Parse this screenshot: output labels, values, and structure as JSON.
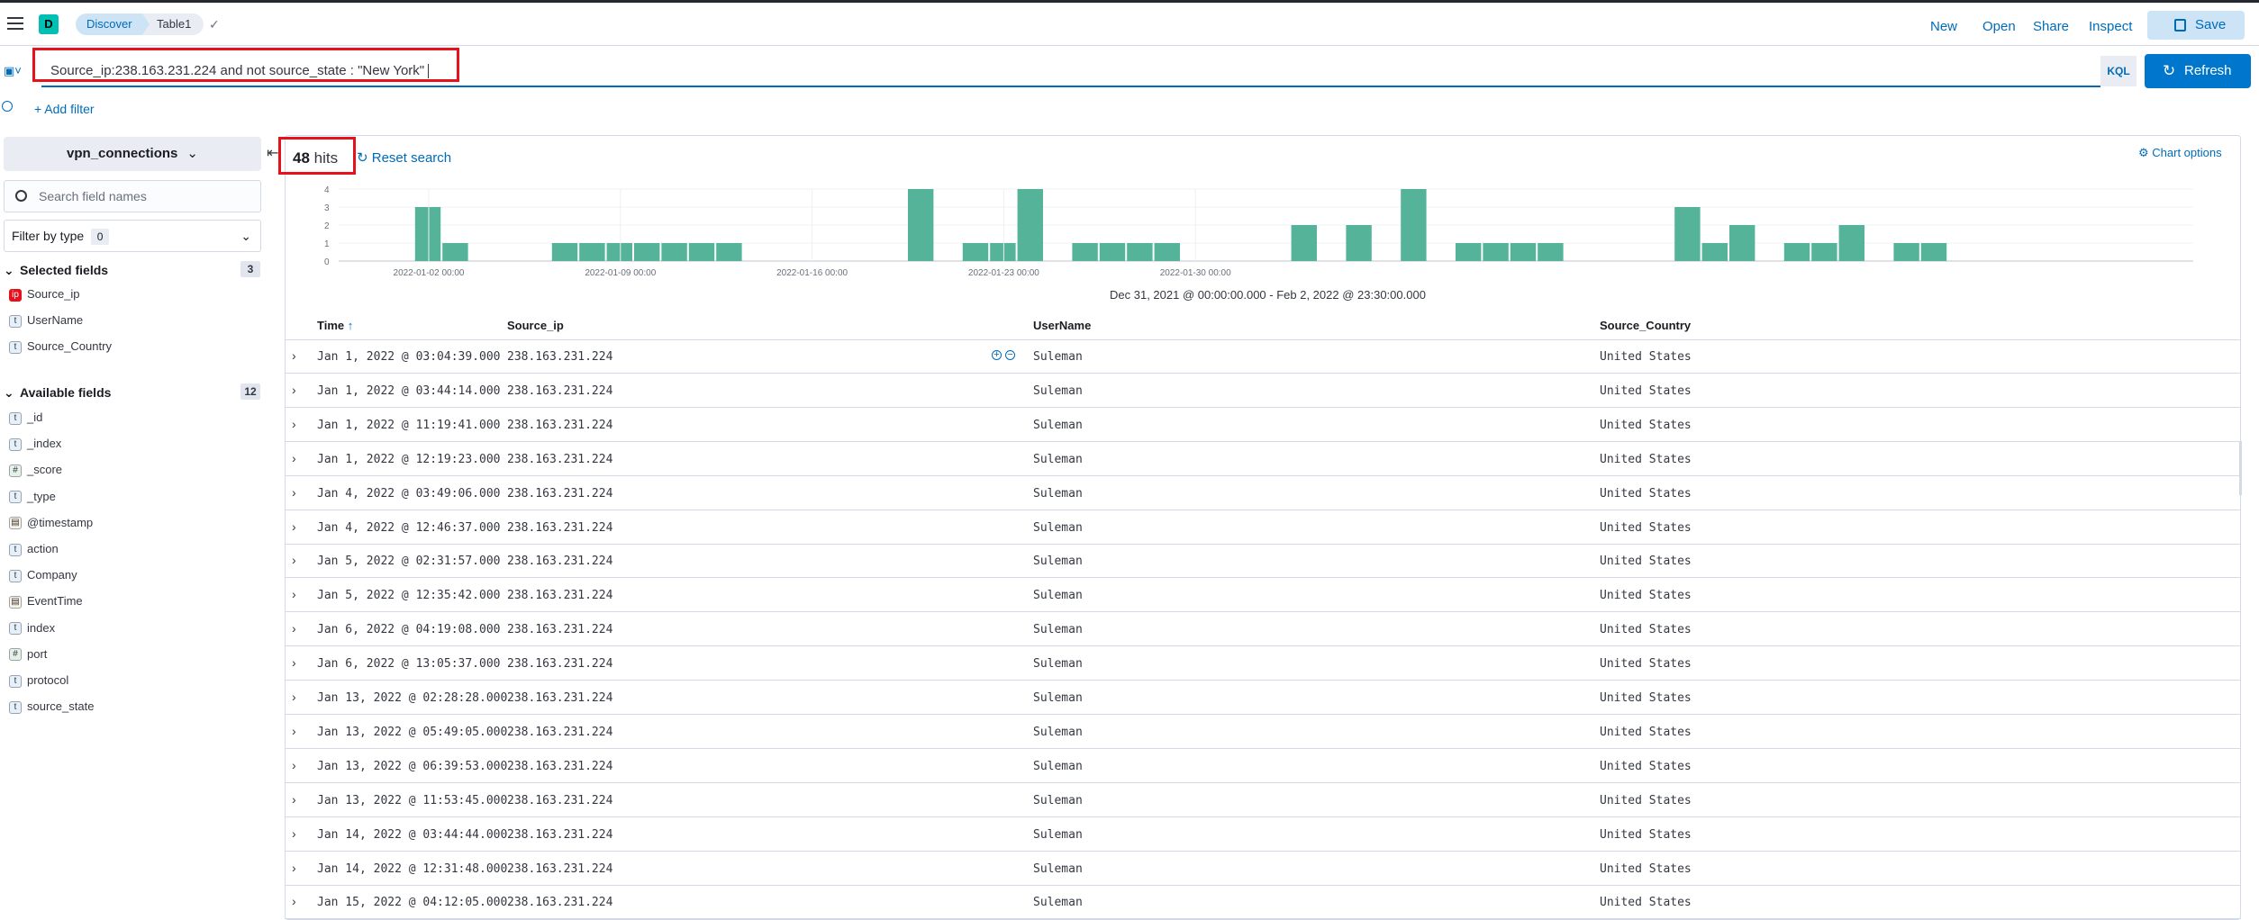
{
  "header": {
    "logo_letter": "D",
    "breadcrumbs": [
      "Discover",
      "Table1"
    ],
    "nav": [
      "New",
      "Open",
      "Share",
      "Inspect"
    ],
    "save_label": "Save"
  },
  "query": {
    "text": "Source_ip:238.163.231.224 and not source_state : \"New York\"",
    "language": "KQL",
    "refresh_label": "Refresh",
    "add_filter": "+ Add filter"
  },
  "sidebar": {
    "index_pattern": "vpn_connections",
    "search_placeholder": "Search field names",
    "filter_by_type": "Filter by type",
    "filter_count": "0",
    "selected_title": "Selected fields",
    "selected_count": "3",
    "selected_fields": [
      {
        "name": "Source_ip",
        "type": "ip"
      },
      {
        "name": "UserName",
        "type": "t"
      },
      {
        "name": "Source_Country",
        "type": "t"
      }
    ],
    "available_title": "Available fields",
    "available_count": "12",
    "available_fields": [
      {
        "name": "_id",
        "type": "t"
      },
      {
        "name": "_index",
        "type": "t"
      },
      {
        "name": "_score",
        "type": "#"
      },
      {
        "name": "_type",
        "type": "t"
      },
      {
        "name": "@timestamp",
        "type": "date"
      },
      {
        "name": "action",
        "type": "t"
      },
      {
        "name": "Company",
        "type": "t"
      },
      {
        "name": "EventTime",
        "type": "date"
      },
      {
        "name": "index",
        "type": "t"
      },
      {
        "name": "port",
        "type": "#"
      },
      {
        "name": "protocol",
        "type": "t"
      },
      {
        "name": "source_state",
        "type": "t"
      }
    ]
  },
  "results": {
    "hits_count": "48",
    "hits_label": "hits",
    "reset_label": "Reset search",
    "chart_options": "Chart options",
    "date_range": "Dec 31, 2021 @ 00:00:00.000 - Feb 2, 2022 @ 23:30:00.000"
  },
  "chart_data": {
    "type": "bar",
    "y_ticks": [
      "0",
      "1",
      "2",
      "3",
      "4"
    ],
    "ylim": [
      0,
      4
    ],
    "x_tick_labels": [
      "2022-01-02 00:00",
      "2022-01-09 00:00",
      "2022-01-16 00:00",
      "2022-01-23 00:00",
      "2022-01-30 00:00"
    ],
    "bar_color": "#54b399",
    "bars": [
      {
        "slot": 2,
        "value": 3
      },
      {
        "slot": 3,
        "value": 1
      },
      {
        "slot": 7,
        "value": 1
      },
      {
        "slot": 8,
        "value": 1
      },
      {
        "slot": 9,
        "value": 1
      },
      {
        "slot": 10,
        "value": 1
      },
      {
        "slot": 11,
        "value": 1
      },
      {
        "slot": 12,
        "value": 1
      },
      {
        "slot": 13,
        "value": 1
      },
      {
        "slot": 20,
        "value": 4
      },
      {
        "slot": 22,
        "value": 1
      },
      {
        "slot": 23,
        "value": 1
      },
      {
        "slot": 24,
        "value": 4
      },
      {
        "slot": 26,
        "value": 1
      },
      {
        "slot": 27,
        "value": 1
      },
      {
        "slot": 28,
        "value": 1
      },
      {
        "slot": 29,
        "value": 1
      },
      {
        "slot": 34,
        "value": 2
      },
      {
        "slot": 36,
        "value": 2
      },
      {
        "slot": 38,
        "value": 4
      },
      {
        "slot": 40,
        "value": 1
      },
      {
        "slot": 41,
        "value": 1
      },
      {
        "slot": 42,
        "value": 1
      },
      {
        "slot": 43,
        "value": 1
      },
      {
        "slot": 48,
        "value": 3
      },
      {
        "slot": 49,
        "value": 1
      },
      {
        "slot": 50,
        "value": 2
      },
      {
        "slot": 52,
        "value": 1
      },
      {
        "slot": 53,
        "value": 1
      },
      {
        "slot": 54,
        "value": 2
      },
      {
        "slot": 56,
        "value": 1
      },
      {
        "slot": 57,
        "value": 1
      }
    ]
  },
  "table": {
    "columns": [
      "Time",
      "Source_ip",
      "UserName",
      "Source_Country"
    ],
    "rows": [
      [
        "Jan 1, 2022 @ 03:04:39.000",
        "238.163.231.224",
        "Suleman",
        "United States"
      ],
      [
        "Jan 1, 2022 @ 03:44:14.000",
        "238.163.231.224",
        "Suleman",
        "United States"
      ],
      [
        "Jan 1, 2022 @ 11:19:41.000",
        "238.163.231.224",
        "Suleman",
        "United States"
      ],
      [
        "Jan 1, 2022 @ 12:19:23.000",
        "238.163.231.224",
        "Suleman",
        "United States"
      ],
      [
        "Jan 4, 2022 @ 03:49:06.000",
        "238.163.231.224",
        "Suleman",
        "United States"
      ],
      [
        "Jan 4, 2022 @ 12:46:37.000",
        "238.163.231.224",
        "Suleman",
        "United States"
      ],
      [
        "Jan 5, 2022 @ 02:31:57.000",
        "238.163.231.224",
        "Suleman",
        "United States"
      ],
      [
        "Jan 5, 2022 @ 12:35:42.000",
        "238.163.231.224",
        "Suleman",
        "United States"
      ],
      [
        "Jan 6, 2022 @ 04:19:08.000",
        "238.163.231.224",
        "Suleman",
        "United States"
      ],
      [
        "Jan 6, 2022 @ 13:05:37.000",
        "238.163.231.224",
        "Suleman",
        "United States"
      ],
      [
        "Jan 13, 2022 @ 02:28:28.000",
        "238.163.231.224",
        "Suleman",
        "United States"
      ],
      [
        "Jan 13, 2022 @ 05:49:05.000",
        "238.163.231.224",
        "Suleman",
        "United States"
      ],
      [
        "Jan 13, 2022 @ 06:39:53.000",
        "238.163.231.224",
        "Suleman",
        "United States"
      ],
      [
        "Jan 13, 2022 @ 11:53:45.000",
        "238.163.231.224",
        "Suleman",
        "United States"
      ],
      [
        "Jan 14, 2022 @ 03:44:44.000",
        "238.163.231.224",
        "Suleman",
        "United States"
      ],
      [
        "Jan 14, 2022 @ 12:31:48.000",
        "238.163.231.224",
        "Suleman",
        "United States"
      ],
      [
        "Jan 15, 2022 @ 04:12:05.000",
        "238.163.231.224",
        "Suleman",
        "United States"
      ]
    ]
  }
}
